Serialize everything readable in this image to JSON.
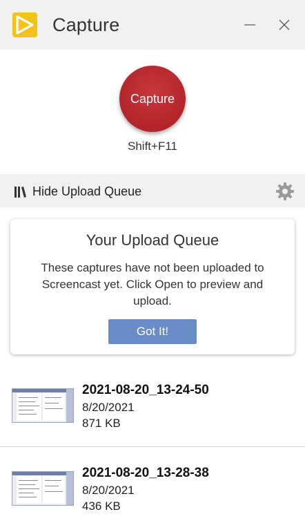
{
  "window": {
    "title": "Capture",
    "logo_icon": "capture-app-logo-icon",
    "minimize_icon": "minimize-icon",
    "close_icon": "close-icon"
  },
  "capture": {
    "button_label": "Capture",
    "shortcut": "Shift+F11",
    "button_color": "#b3252b"
  },
  "queue_bar": {
    "toggle_label": "Hide Upload Queue",
    "toggle_icon": "library-books-icon",
    "settings_icon": "gear-icon"
  },
  "info_card": {
    "title": "Your Upload Queue",
    "body": "These captures have not been uploaded to Screencast yet. Click Open to preview and upload.",
    "button_label": "Got It!",
    "button_color": "#6a8cc6"
  },
  "captures": [
    {
      "name": "2021-08-20_13-24-50",
      "date": "8/20/2021",
      "size": "871 KB"
    },
    {
      "name": "2021-08-20_13-28-38",
      "date": "8/20/2021",
      "size": "436 KB"
    }
  ]
}
